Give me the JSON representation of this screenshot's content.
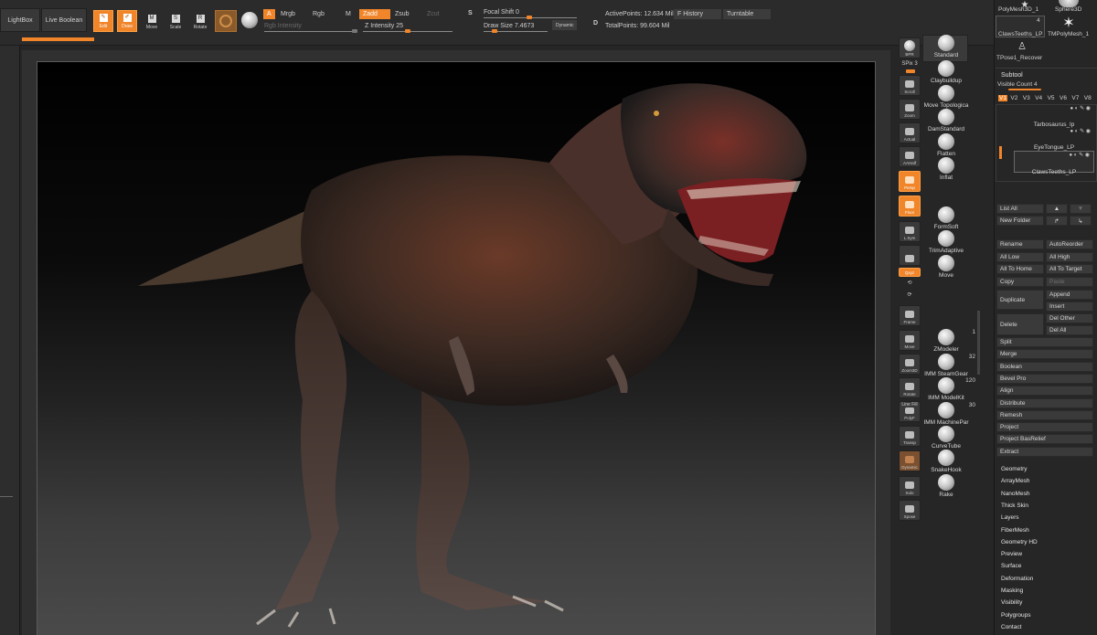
{
  "topbar": {
    "lightbox": "LightBox",
    "live_boolean": "Live Boolean",
    "tools": {
      "edit": "Edit",
      "draw": "Draw",
      "move": "Move",
      "scale": "Scale",
      "rotate": "Rotate"
    },
    "mode_a": "A",
    "mrgb": "Mrgb",
    "rgb": "Rgb",
    "m": "M",
    "rgb_intensity": "Rgb Intensity",
    "zadd": "Zadd",
    "zsub": "Zsub",
    "zcut": "Zcut",
    "z_intensity": "Z Intensity 25",
    "focal_shift": "Focal Shift 0",
    "draw_size": "Draw Size 7.4673",
    "dynamic": "Dynamic",
    "active_points": "ActivePoints: 12.634 Mil",
    "total_points": "TotalPoints: 99.604 Mil",
    "f_history": "F History",
    "turntable": "Turntable",
    "s_key": "S",
    "d_key": "D"
  },
  "right_tools": {
    "bpr": "BPR",
    "spix": "SPix 3",
    "scroll": "Scroll",
    "zoom": "Zoom",
    "actual": "Actual",
    "aahalf": "AAHalf",
    "persp": "Persp",
    "floor": "Floor",
    "lsym": "L.Sym",
    "xyz": "Qxyz",
    "frame": "Frame",
    "move": "Move",
    "zoom3d": "Zoom3D",
    "rotate": "Rotate",
    "linefill": "Line Fill",
    "polyf": "PolyF",
    "transp": "Transp",
    "dynamic": "Dynamic",
    "solo": "Solo",
    "xpose": "Xpose"
  },
  "brushes": [
    {
      "label": "Standard",
      "num": ""
    },
    {
      "label": "Claybuildup",
      "num": ""
    },
    {
      "label": "Move Topologica",
      "num": ""
    },
    {
      "label": "DamStandard",
      "num": ""
    },
    {
      "label": "Flatten",
      "num": ""
    },
    {
      "label": "Inflat",
      "num": ""
    },
    {
      "label": "FormSoft",
      "num": ""
    },
    {
      "label": "TrimAdaptive",
      "num": ""
    },
    {
      "label": "Move",
      "num": ""
    },
    {
      "label": "ZModeler",
      "num": "1"
    },
    {
      "label": "IMM SteamGear",
      "num": "32"
    },
    {
      "label": "IMM ModelKit",
      "num": "120"
    },
    {
      "label": "IMM MachinePar",
      "num": "30"
    },
    {
      "label": "CurveTube",
      "num": ""
    },
    {
      "label": "SnakeHook",
      "num": ""
    },
    {
      "label": "Rake",
      "num": ""
    }
  ],
  "tool_thumbs": {
    "polymesh": "PolyMesh3D_1",
    "sphere": "Sphere3D",
    "claws_count": "4",
    "claws": "ClawsTeeths_LP",
    "tmpoly": "TMPolyMesh_1",
    "tpose": "TPose1_Recover"
  },
  "subtool": {
    "title": "Subtool",
    "visible_count": "Visible Count 4",
    "tabs": [
      "V1",
      "V2",
      "V3",
      "V4",
      "V5",
      "V6",
      "V7",
      "V8"
    ],
    "items": [
      "Tarbosaurus_lp",
      "EyeTongue_LP",
      "ClawsTeeths_LP"
    ]
  },
  "panel_buttons": {
    "list_all": "List All",
    "new_folder": "New Folder",
    "rename": "Rename",
    "auto_reorder": "AutoReorder",
    "all_low": "All Low",
    "all_high": "All High",
    "all_to_home": "All To Home",
    "all_to_target": "All To Target",
    "copy": "Copy",
    "paste": "Paste",
    "duplicate": "Duplicate",
    "append": "Append",
    "insert": "Insert",
    "delete": "Delete",
    "del_other": "Del Other",
    "del_all": "Del All"
  },
  "panel_actions": [
    "Split",
    "Merge",
    "Boolean",
    "Bevel Pro",
    "Align",
    "Distribute",
    "Remesh",
    "Project",
    "Project BasRelief",
    "Extract"
  ],
  "panel_menus": [
    "Geometry",
    "ArrayMesh",
    "NanoMesh",
    "Thick Skin",
    "Layers",
    "FiberMesh",
    "Geometry HD",
    "Preview",
    "Surface",
    "Deformation",
    "Masking",
    "Visibility",
    "Polygroups",
    "Contact"
  ],
  "colors": {
    "accent": "#f0852a",
    "panel": "#262626",
    "toolbar": "#2b2b2b"
  }
}
